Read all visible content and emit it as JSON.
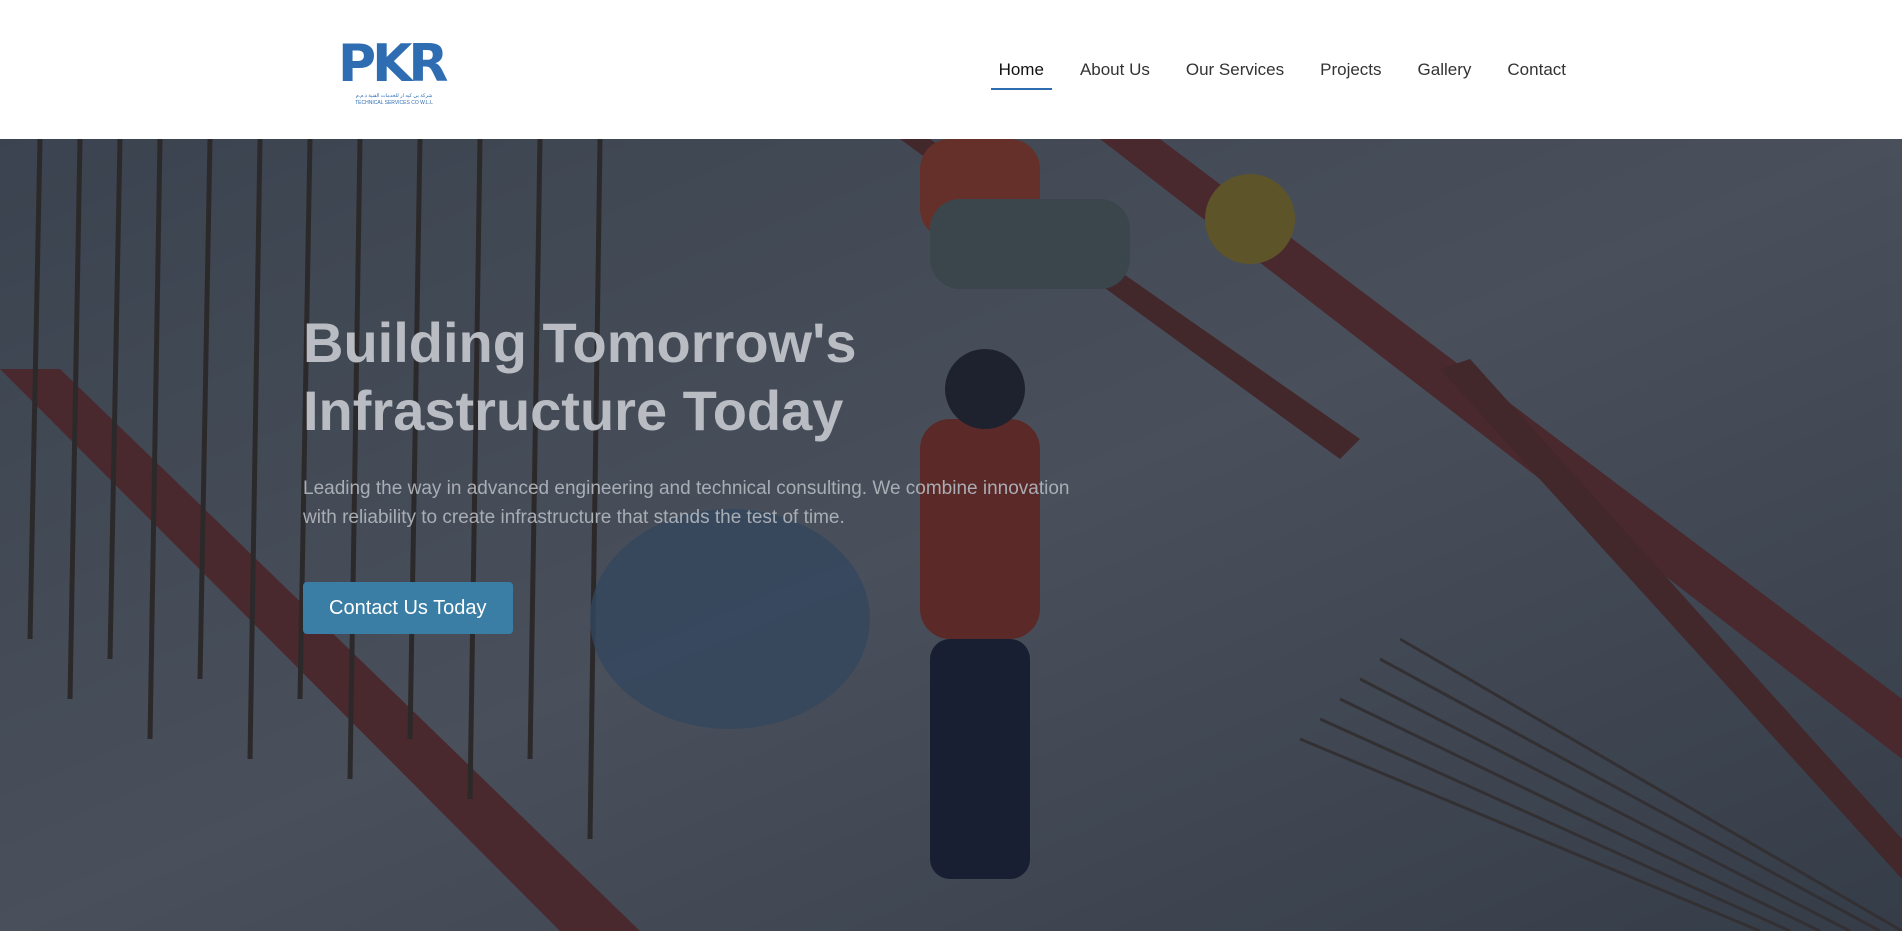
{
  "header": {
    "logo": {
      "mark": "PKR",
      "tagline_arabic": "شركة بي كيه آر للخدمات الفنية ذ.م.م",
      "tagline": "TECHNICAL SERVICES CO W.L.L"
    },
    "nav": [
      {
        "label": "Home",
        "active": true
      },
      {
        "label": "About Us",
        "active": false
      },
      {
        "label": "Our Services",
        "active": false
      },
      {
        "label": "Projects",
        "active": false
      },
      {
        "label": "Gallery",
        "active": false
      },
      {
        "label": "Contact",
        "active": false
      }
    ]
  },
  "hero": {
    "title_line1": "Building Tomorrow's",
    "title_line2": "Infrastructure Today",
    "description": "Leading the way in advanced engineering and technical consulting. We combine innovation with reliability to create infrastructure that stands the test of time.",
    "cta_label": "Contact Us Today"
  },
  "colors": {
    "brand": "#2f6db3",
    "button": "#3a7ea6",
    "nav_underline": "#2f6db3"
  }
}
